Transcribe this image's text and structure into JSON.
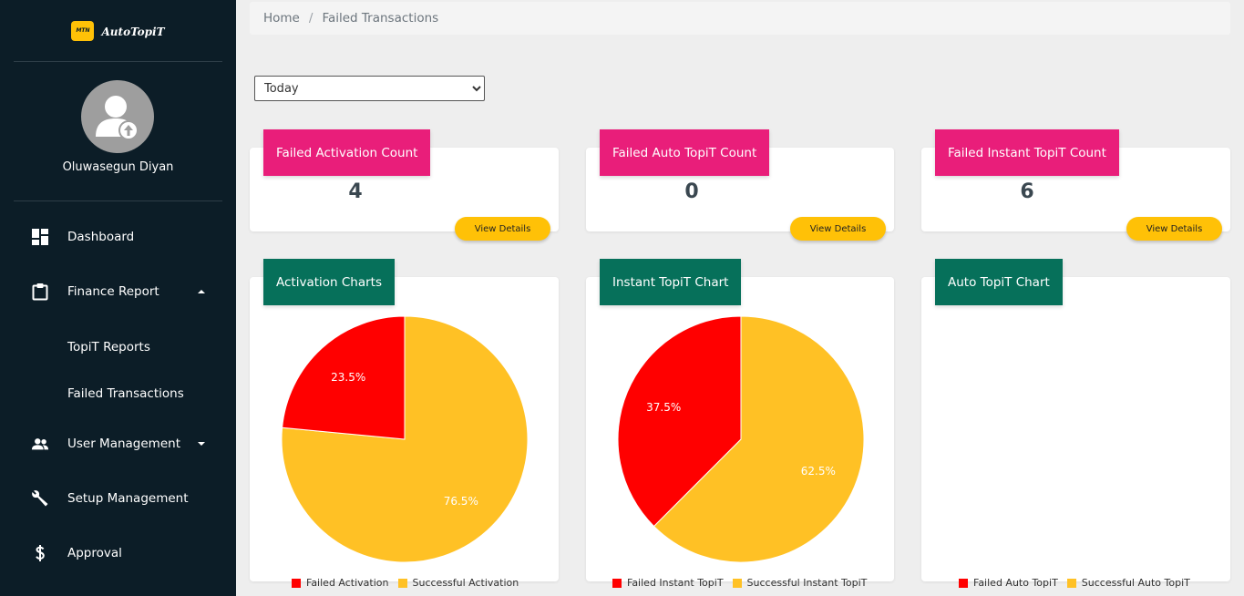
{
  "app": {
    "logo_badge": "MTN",
    "logo_text": "AutoTopiT"
  },
  "user": {
    "name": "Oluwasegun Diyan"
  },
  "sidebar": {
    "items": [
      {
        "label": "Dashboard",
        "icon": "dashboard-icon"
      },
      {
        "label": "Finance Report",
        "icon": "clipboard-icon"
      },
      {
        "label": "User Management",
        "icon": "people-icon"
      },
      {
        "label": "Setup Management",
        "icon": "wrench-icon"
      },
      {
        "label": "Approval",
        "icon": "dollar-icon"
      }
    ],
    "sub_items": [
      {
        "label": "TopiT Reports"
      },
      {
        "label": "Failed Transactions"
      }
    ]
  },
  "breadcrumb": {
    "home": "Home",
    "separator": "/",
    "current": "Failed Transactions"
  },
  "filter": {
    "selected": "Today"
  },
  "stats": [
    {
      "title": "Failed Activation Count",
      "count": "4",
      "button": "View Details"
    },
    {
      "title": "Failed Auto TopiT Count",
      "count": "0",
      "button": "View Details"
    },
    {
      "title": "Failed Instant TopiT Count",
      "count": "6",
      "button": "View Details"
    }
  ],
  "charts": [
    {
      "title": "Activation Charts"
    },
    {
      "title": "Instant TopiT Chart"
    },
    {
      "title": "Auto TopiT Chart"
    }
  ],
  "colors": {
    "failed": "#ff0000",
    "success": "#ffc125",
    "pink": "#e91e7a",
    "green": "#06705a",
    "sidebar": "#0c1d27",
    "button": "#ffc107"
  },
  "chart_data": [
    {
      "type": "pie",
      "title": "Activation Charts",
      "slices": [
        {
          "label": "Failed Activation",
          "value": 23.5,
          "display": "23.5%"
        },
        {
          "label": "Successful Activation",
          "value": 76.5,
          "display": "76.5%"
        }
      ],
      "legend": "bottom"
    },
    {
      "type": "pie",
      "title": "Instant TopiT Chart",
      "slices": [
        {
          "label": "Failed Instant TopiT",
          "value": 37.5,
          "display": "37.5%"
        },
        {
          "label": "Successful Instant TopiT",
          "value": 62.5,
          "display": "62.5%"
        }
      ],
      "legend": "bottom"
    },
    {
      "type": "pie",
      "title": "Auto TopiT Chart",
      "slices": [
        {
          "label": "Failed Auto TopiT",
          "value": 0,
          "display": ""
        },
        {
          "label": "Successful Auto TopiT",
          "value": 0,
          "display": ""
        }
      ],
      "legend": "bottom"
    }
  ]
}
